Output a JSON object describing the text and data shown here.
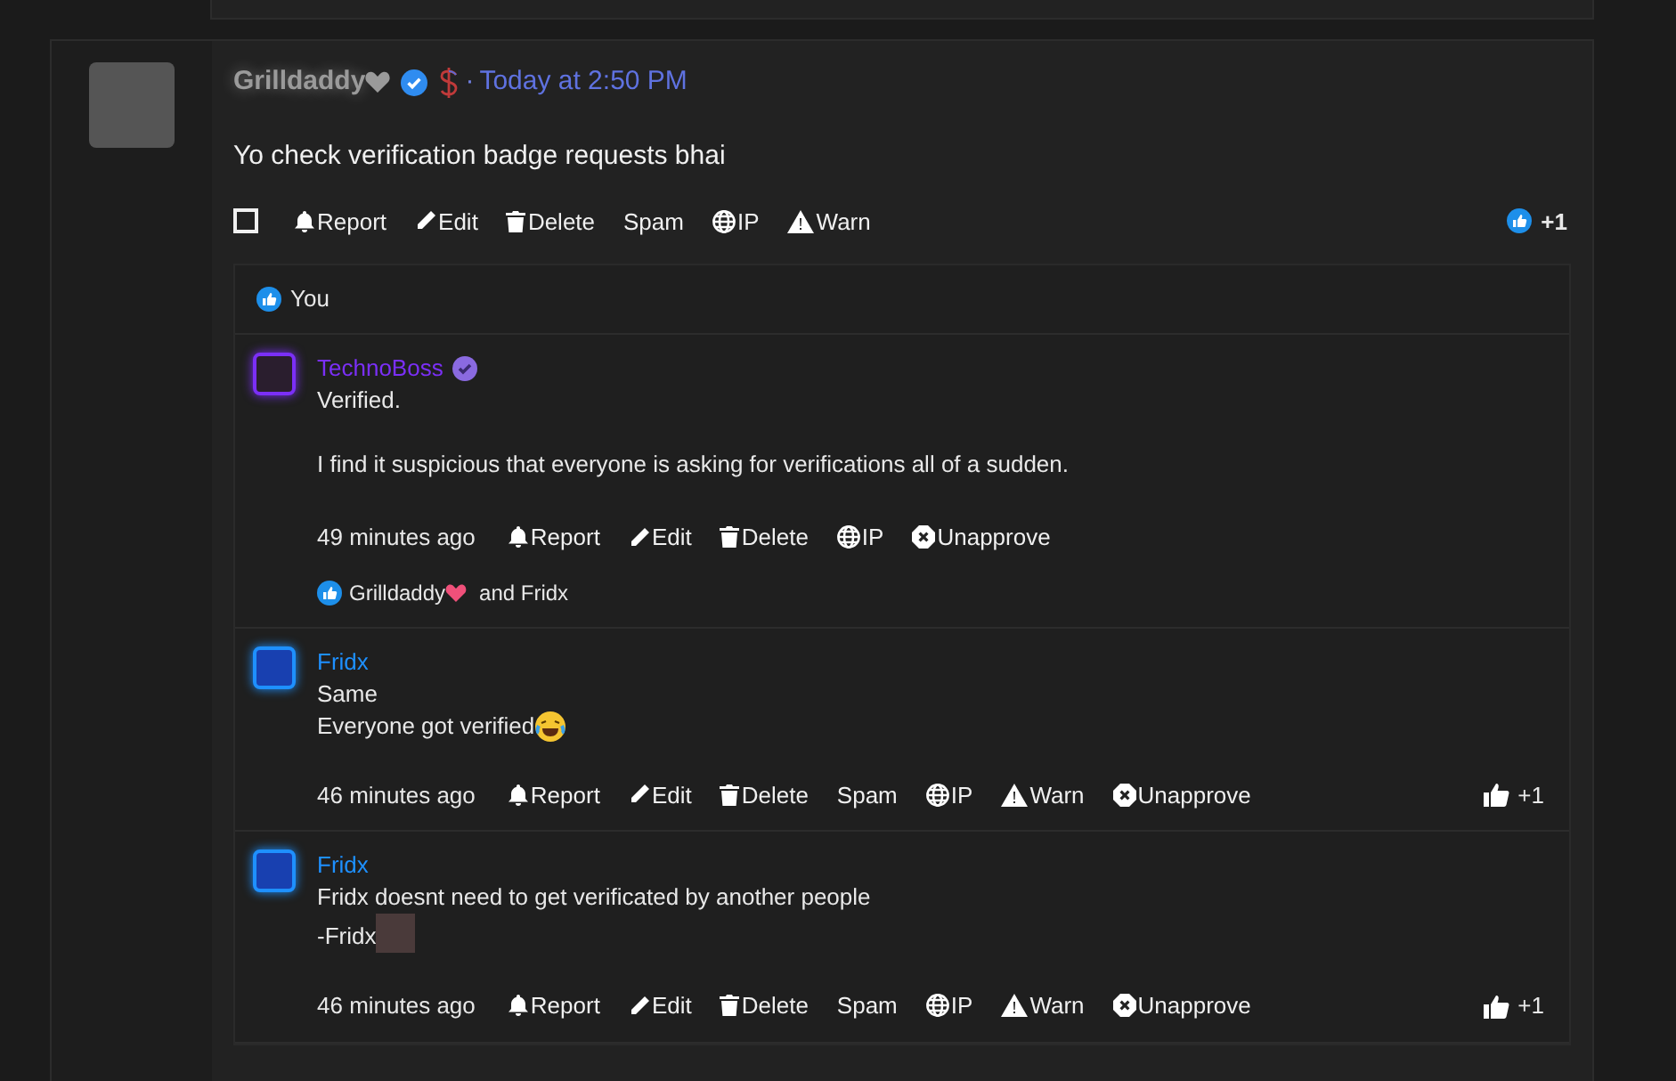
{
  "post": {
    "author": "Grilldaddy",
    "verified": true,
    "separator": "·",
    "time": "Today at 2:50 PM",
    "body": "Yo check verification badge requests bhai",
    "selected": false,
    "actions": [
      {
        "kind": "report",
        "label": "Report"
      },
      {
        "kind": "edit",
        "label": "Edit"
      },
      {
        "kind": "delete",
        "label": "Delete"
      },
      {
        "kind": "spam",
        "label": "Spam"
      },
      {
        "kind": "ip",
        "label": "IP"
      },
      {
        "kind": "warn",
        "label": "Warn"
      }
    ],
    "reaction_count": "+1"
  },
  "reactions_bar": {
    "label": "You"
  },
  "comments": [
    {
      "author": "TechnoBoss",
      "color": "#7b2ff7",
      "verified": true,
      "paragraphs": [
        {
          "lines": [
            {
              "kind": "plain",
              "text": "Verified."
            }
          ]
        },
        {
          "lines": [
            {
              "kind": "plain",
              "text": "I find it suspicious that everyone is asking for verifications all of a sudden."
            }
          ]
        }
      ],
      "time": "49 minutes ago",
      "actions": [
        {
          "kind": "report",
          "label": "Report"
        },
        {
          "kind": "edit",
          "label": "Edit"
        },
        {
          "kind": "delete",
          "label": "Delete"
        },
        {
          "kind": "ip",
          "label": "IP"
        },
        {
          "kind": "unapprove",
          "label": "Unapprove"
        }
      ],
      "likes": {
        "first": "Grilldaddy",
        "rest": "and Fridx"
      }
    },
    {
      "author": "Fridx",
      "color": "#1e90ff",
      "verified": false,
      "paragraphs": [
        {
          "lines": [
            {
              "kind": "plain",
              "text": "Same"
            },
            {
              "kind": "emoji",
              "text": "Everyone got verified"
            }
          ]
        }
      ],
      "time": "46 minutes ago",
      "actions": [
        {
          "kind": "report",
          "label": "Report"
        },
        {
          "kind": "edit",
          "label": "Edit"
        },
        {
          "kind": "delete",
          "label": "Delete"
        },
        {
          "kind": "spam",
          "label": "Spam"
        },
        {
          "kind": "ip",
          "label": "IP"
        },
        {
          "kind": "warn",
          "label": "Warn"
        },
        {
          "kind": "unapprove",
          "label": "Unapprove"
        }
      ],
      "like_count": "+1"
    },
    {
      "author": "Fridx",
      "color": "#1e90ff",
      "verified": false,
      "paragraphs": [
        {
          "lines": [
            {
              "kind": "plain",
              "text": "Fridx doesnt need to get verificated by another people"
            },
            {
              "kind": "photo",
              "text": "-Fridx"
            }
          ]
        }
      ],
      "time": "46 minutes ago",
      "actions": [
        {
          "kind": "report",
          "label": "Report"
        },
        {
          "kind": "edit",
          "label": "Edit"
        },
        {
          "kind": "delete",
          "label": "Delete"
        },
        {
          "kind": "spam",
          "label": "Spam"
        },
        {
          "kind": "ip",
          "label": "IP"
        },
        {
          "kind": "warn",
          "label": "Warn"
        },
        {
          "kind": "unapprove",
          "label": "Unapprove"
        }
      ],
      "like_count": "+1"
    }
  ]
}
